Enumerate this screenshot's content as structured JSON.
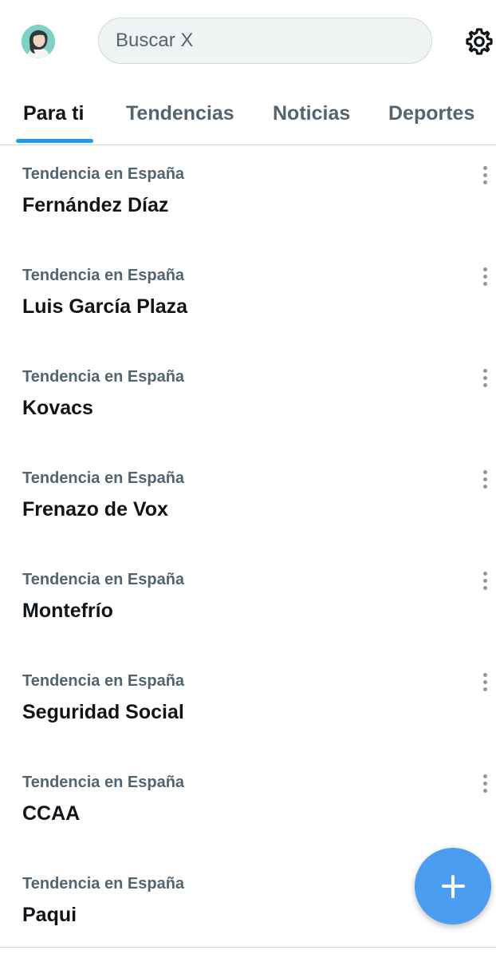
{
  "header": {
    "avatar_icon": "profile-avatar",
    "search": {
      "placeholder": "Buscar X",
      "value": ""
    },
    "settings_icon": "gear-icon"
  },
  "tabs": [
    {
      "label": "Para ti",
      "active": true
    },
    {
      "label": "Tendencias",
      "active": false
    },
    {
      "label": "Noticias",
      "active": false
    },
    {
      "label": "Deportes",
      "active": false
    }
  ],
  "trends": [
    {
      "context": "Tendencia en España",
      "name": "Fernández Díaz"
    },
    {
      "context": "Tendencia en España",
      "name": "Luis García Plaza"
    },
    {
      "context": "Tendencia en España",
      "name": "Kovacs"
    },
    {
      "context": "Tendencia en España",
      "name": "Frenazo de Vox"
    },
    {
      "context": "Tendencia en España",
      "name": "Montefrío"
    },
    {
      "context": "Tendencia en España",
      "name": "Seguridad Social"
    },
    {
      "context": "Tendencia en España",
      "name": "CCAA"
    },
    {
      "context": "Tendencia en España",
      "name": "Paqui"
    }
  ],
  "fab": {
    "icon": "plus-icon"
  },
  "colors": {
    "accent": "#1d9bf0",
    "fab": "#4a9df0",
    "text_primary": "#0f1419",
    "text_secondary": "#536471",
    "search_bg": "#eff3f4"
  }
}
